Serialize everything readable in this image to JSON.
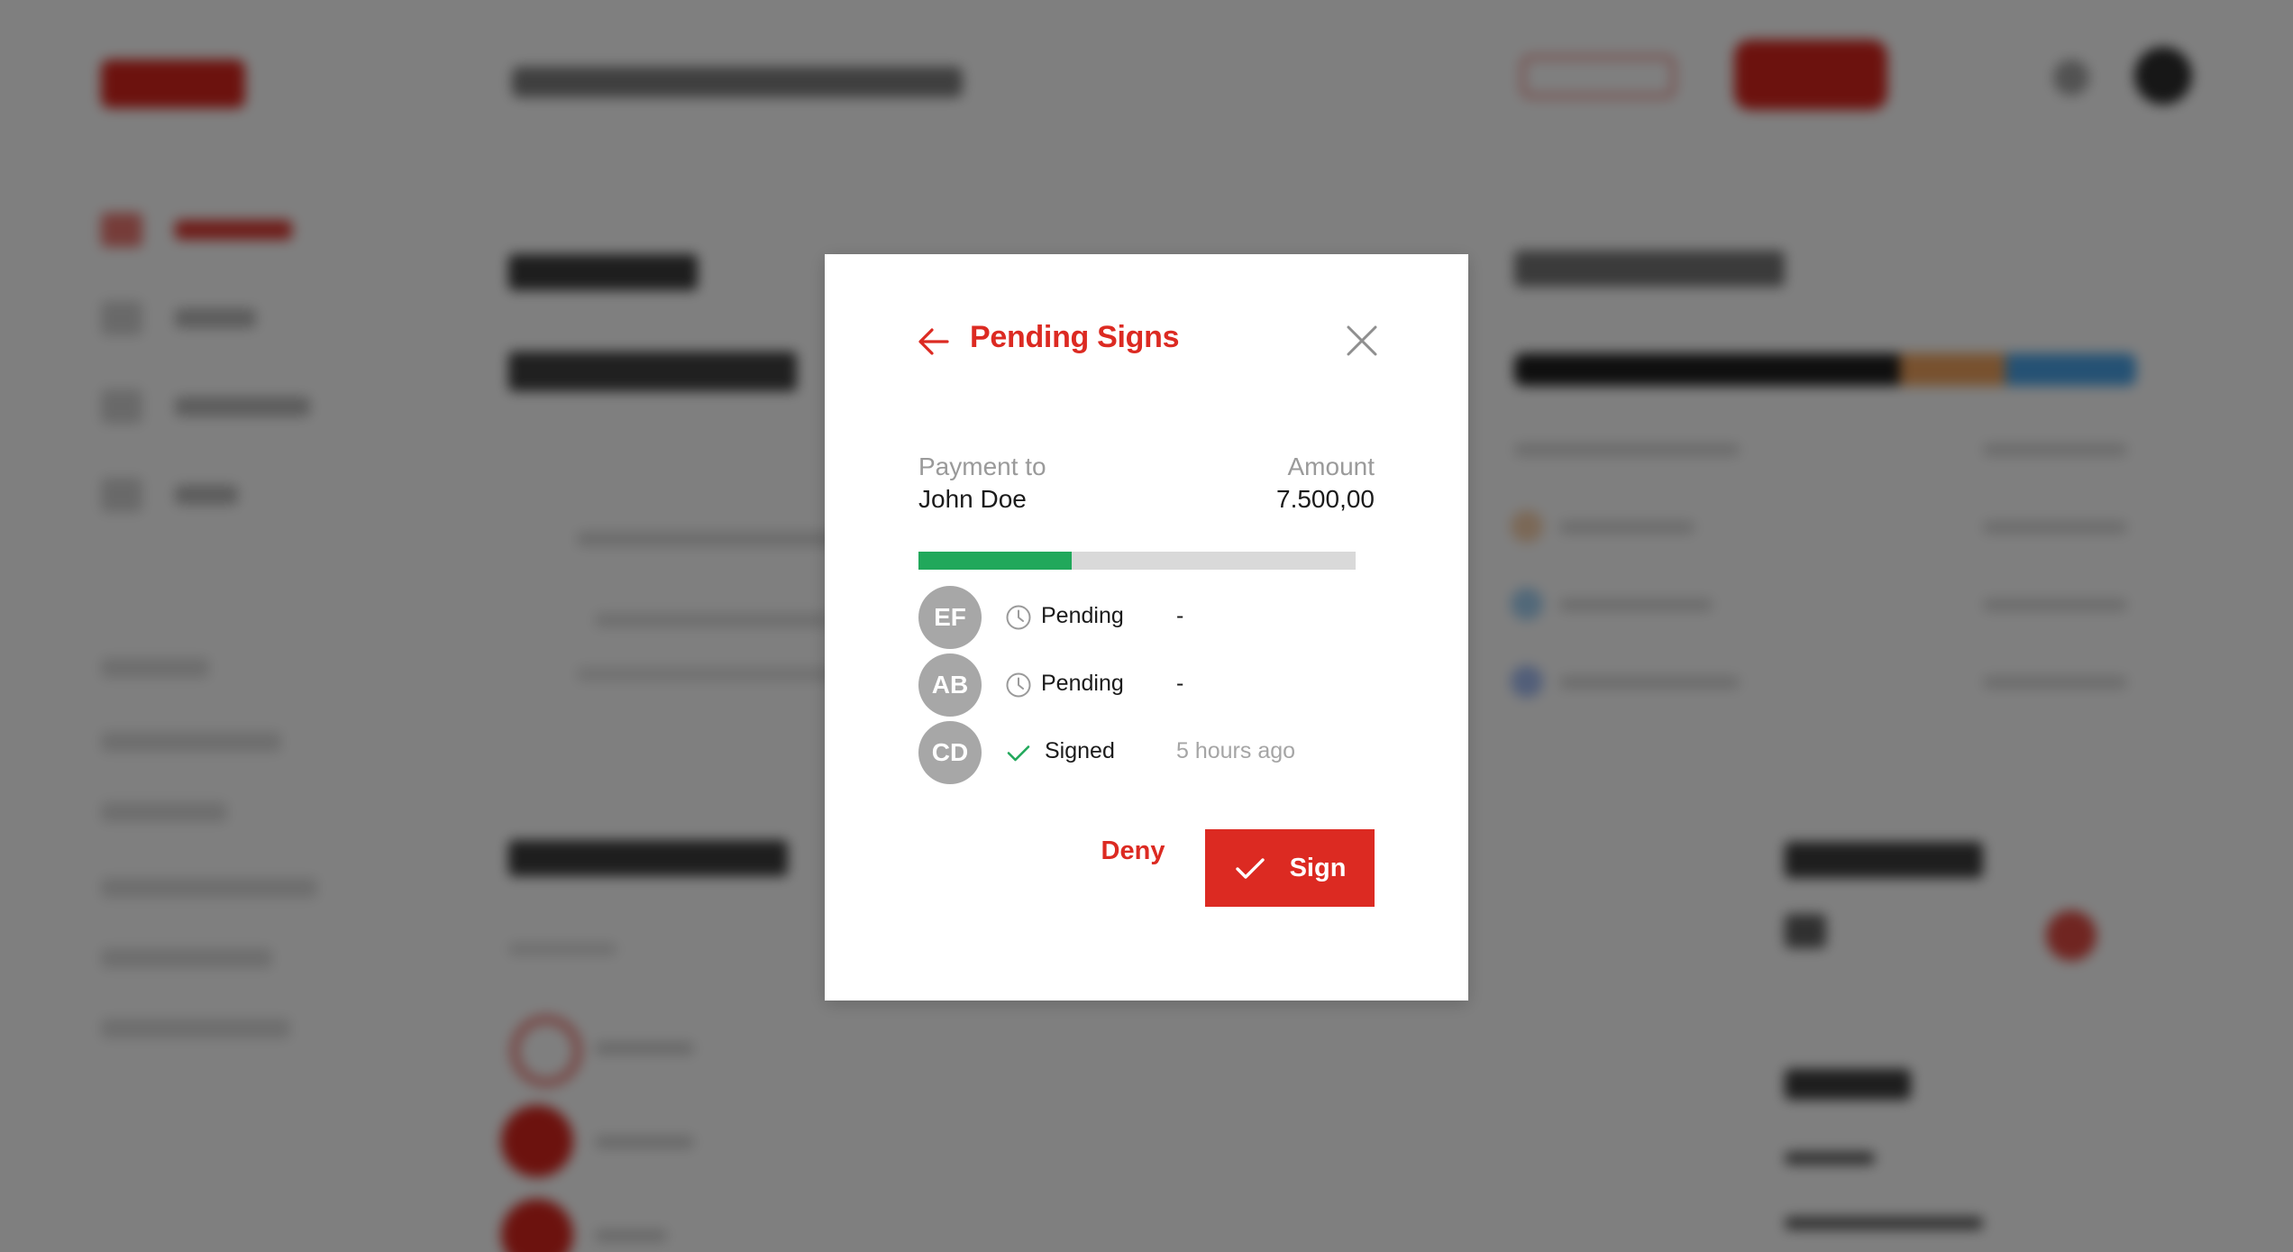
{
  "modal": {
    "title": "Pending Signs",
    "payment_label": "Payment to",
    "payee": "John Doe",
    "amount_label": "Amount",
    "amount": "7.500,00",
    "progress_fraction": 0.35,
    "deny_label": "Deny",
    "sign_label": "Sign",
    "signers": [
      {
        "initials": "EF",
        "status": "Pending",
        "status_icon": "clock-icon",
        "time": "-"
      },
      {
        "initials": "AB",
        "status": "Pending",
        "status_icon": "clock-icon",
        "time": "-"
      },
      {
        "initials": "CD",
        "status": "Signed",
        "status_icon": "checkmark-icon",
        "time": "5 hours ago"
      }
    ]
  },
  "colors": {
    "brand_red": "#dc2a22",
    "progress_green": "#21a85b",
    "avatar_gray": "#a7a7a7",
    "overlay": "rgba(0,0,0,0.5)"
  }
}
